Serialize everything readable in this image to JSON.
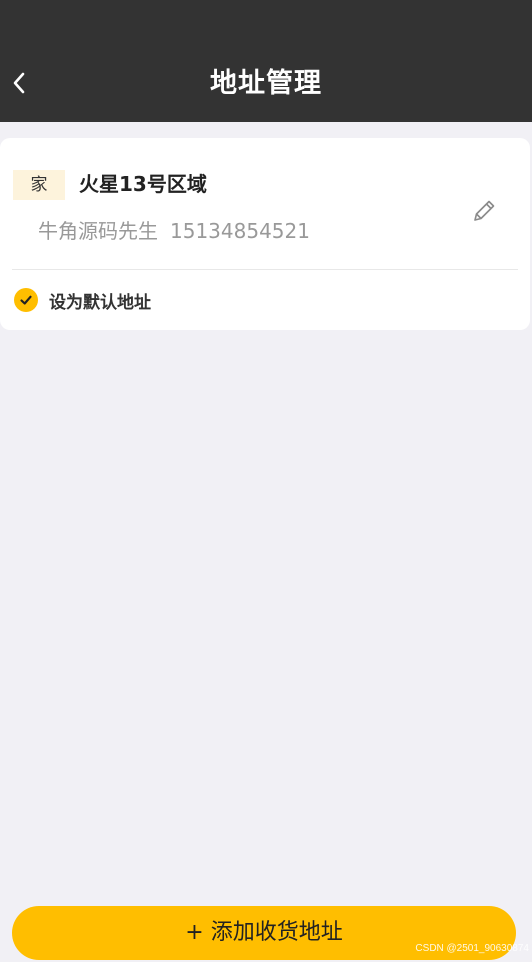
{
  "header": {
    "title": "地址管理",
    "background_color": "#333333"
  },
  "address_card": {
    "tag": "家",
    "address": "火星13号区域",
    "name": "牛角源码先生",
    "phone": "15134854521",
    "default_label": "设为默认地址",
    "is_default": true
  },
  "add_button": {
    "label": "+ 添加收货地址"
  },
  "watermark": "CSDN @2501_90630874",
  "colors": {
    "accent": "#ffbe00",
    "page_background": "#f1f0f5",
    "tag_background": "#fdf3dc"
  }
}
